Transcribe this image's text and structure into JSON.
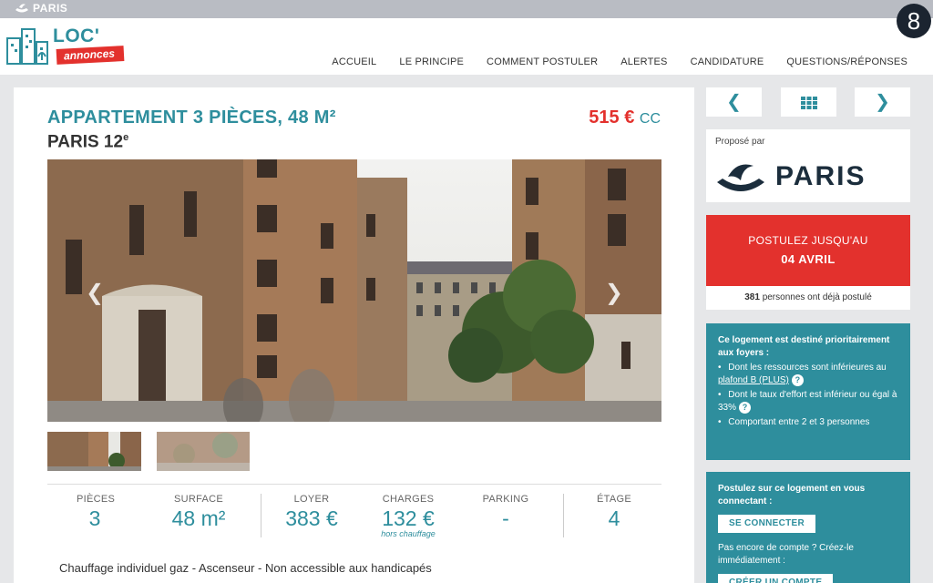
{
  "citybar": {
    "city": "PARIS",
    "badge": "8"
  },
  "brand": {
    "name": "LOC'",
    "tagline": "annonces"
  },
  "nav": [
    "ACCUEIL",
    "LE PRINCIPE",
    "COMMENT POSTULER",
    "ALERTES",
    "CANDIDATURE",
    "QUESTIONS/RÉPONSES"
  ],
  "listing": {
    "title": "APPARTEMENT 3 PIÈCES, 48 M²",
    "location_main": "PARIS 12",
    "location_sup": "e",
    "price": "515 €",
    "price_suffix": "CC"
  },
  "gallery": {
    "prev_icon": "chevron-left-icon",
    "next_icon": "chevron-right-icon"
  },
  "stats": [
    {
      "label": "PIÈCES",
      "value": "3"
    },
    {
      "label": "SURFACE",
      "value": "48 m²"
    },
    {
      "label": "LOYER",
      "value": "383 €"
    },
    {
      "label": "CHARGES",
      "value": "132 €",
      "note": "hors chauffage"
    },
    {
      "label": "PARKING",
      "value": "-"
    },
    {
      "label": "ÉTAGE",
      "value": "4"
    }
  ],
  "features": "Chauffage individuel gaz - Ascenseur - Non accessible aux handicapés",
  "sidebar": {
    "proposed_label": "Proposé par",
    "proposed_by": "PARIS",
    "deadline_line1": "POSTULEZ JUSQU'AU",
    "deadline_date": "04 AVRIL",
    "applied_count": "381",
    "applied_text": "personnes ont déjà postulé",
    "priority_head": "Ce logement est destiné prioritairement aux foyers :",
    "priority_items": [
      {
        "text": "Dont les ressources sont inférieures au ",
        "link": "plafond B (PLUS)"
      },
      {
        "text": "Dont le taux d'effort est inférieur ou égal à 33%"
      },
      {
        "text": "Comportant entre 2 et 3 personnes"
      }
    ],
    "login_head": "Postulez sur ce logement en vous connectant :",
    "login_button": "SE CONNECTER",
    "register_text": "Pas encore de compte ? Créez-le immédiatement :",
    "register_button": "CRÉER UN COMPTE"
  },
  "colors": {
    "teal": "#2e8e9d",
    "red": "#e3312d",
    "navy": "#1b2d3c"
  }
}
